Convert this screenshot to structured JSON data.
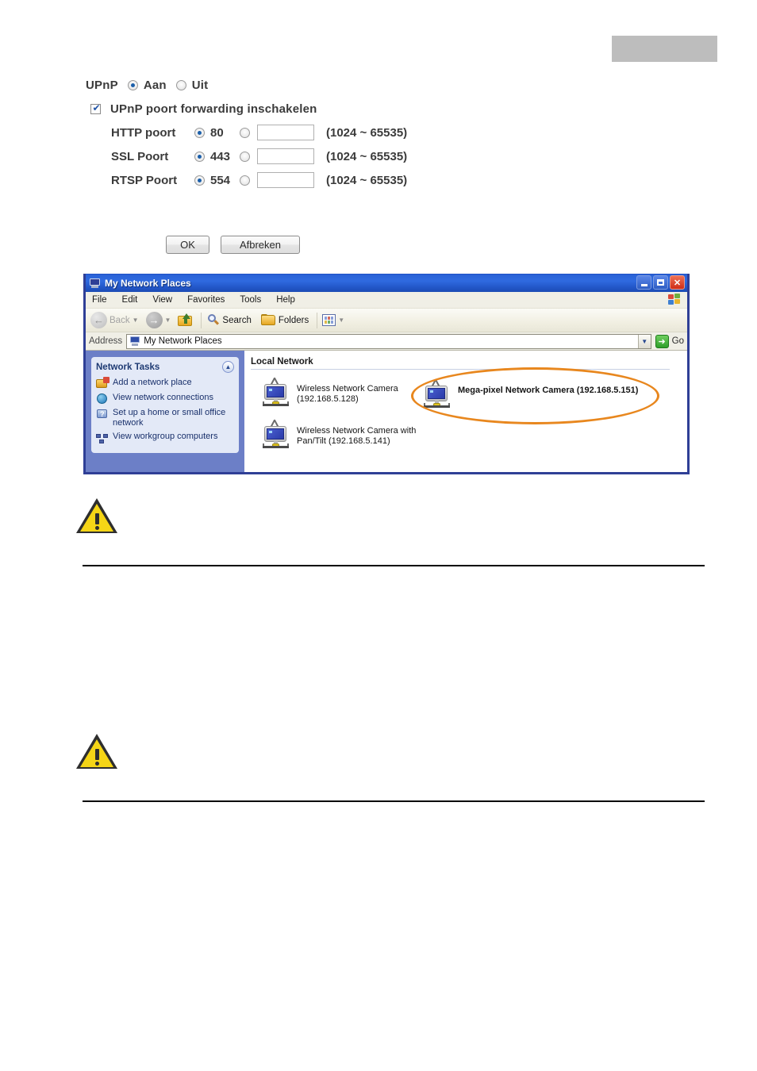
{
  "upnp_form": {
    "upnp_label": "UPnP",
    "option_on": "Aan",
    "option_off": "Uit",
    "port_forwarding_label": "UPnP poort forwarding inschakelen",
    "port_rows": [
      {
        "label": "HTTP poort",
        "default_value": "80",
        "range": "(1024 ~ 65535)",
        "custom_value": ""
      },
      {
        "label": "SSL Poort",
        "default_value": "443",
        "range": "(1024 ~ 65535)",
        "custom_value": ""
      },
      {
        "label": "RTSP Poort",
        "default_value": "554",
        "range": "(1024 ~ 65535)",
        "custom_value": ""
      }
    ],
    "ok_label": "OK",
    "cancel_label": "Afbreken"
  },
  "explorer_window": {
    "title": "My Network Places",
    "menu": [
      "File",
      "Edit",
      "View",
      "Favorites",
      "Tools",
      "Help"
    ],
    "toolbar": {
      "back_label": "Back",
      "search_label": "Search",
      "folders_label": "Folders"
    },
    "address": {
      "label": "Address",
      "value": "My Network Places",
      "go_label": "Go"
    },
    "sidebar": {
      "panel_title": "Network Tasks",
      "items": [
        "Add a network place",
        "View network connections",
        "Set up a home or small office network",
        "View workgroup computers"
      ]
    },
    "content": {
      "heading": "Local Network",
      "devices": [
        {
          "name": "Wireless Network Camera\n(192.168.5.128)",
          "highlighted": "false"
        },
        {
          "name": "Mega-pixel Network Camera (192.168.5.151)",
          "highlighted": "true"
        },
        {
          "name": "Wireless Network Camera with\nPan/Tilt (192.168.5.141)",
          "highlighted": "false"
        }
      ]
    }
  },
  "annotation": {
    "highlight_color": "#e8871e"
  },
  "notes": [
    {
      "icon": "warning-icon",
      "text": ""
    },
    {
      "icon": "warning-icon",
      "text": ""
    }
  ]
}
